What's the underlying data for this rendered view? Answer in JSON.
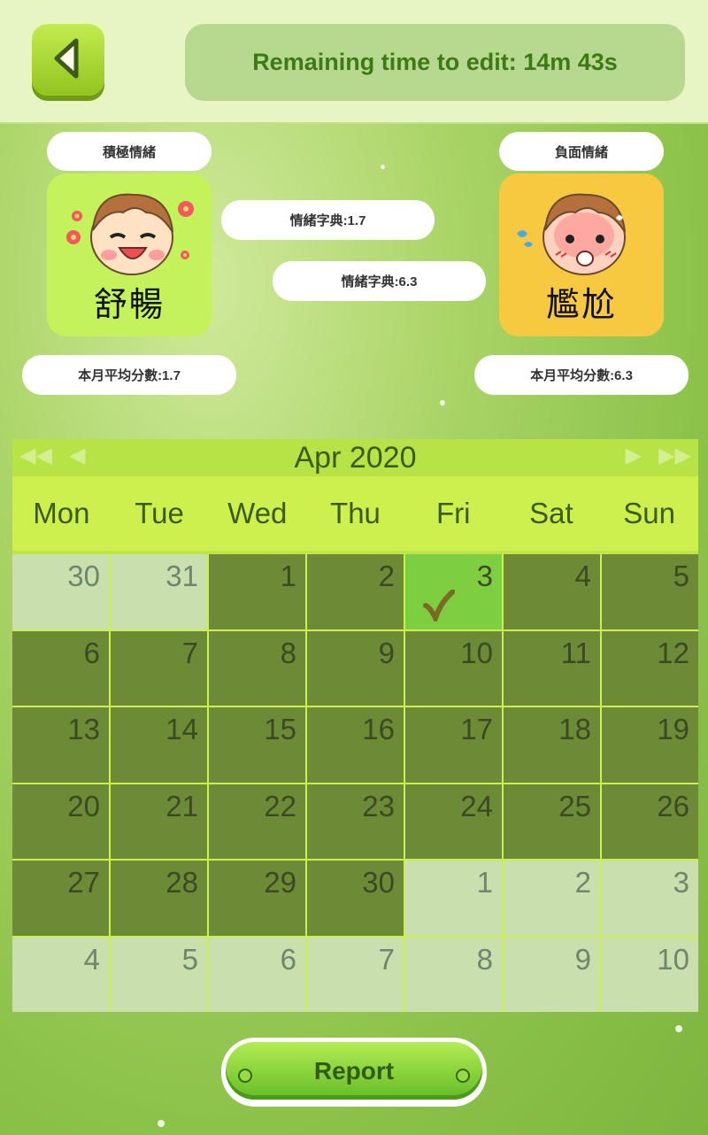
{
  "header": {
    "timer_text": "Remaining time to edit: 14m 43s"
  },
  "positive": {
    "category": "積極情緒",
    "mood_label": "舒暢",
    "dictionary": "情緒字典:1.7",
    "monthly_avg": "本月平均分數:1.7",
    "card_color": "#c3f25a"
  },
  "negative": {
    "category": "負面情緒",
    "mood_label": "尷尬",
    "dictionary": "情緒字典:6.3",
    "monthly_avg": "本月平均分數:6.3",
    "card_color": "#f6c940"
  },
  "calendar": {
    "month_label": "Apr 2020",
    "nav": {
      "prev_year": "◀◀",
      "prev_month": "◀",
      "next_month": "▶",
      "next_year": "▶▶"
    },
    "weekdays": [
      "Mon",
      "Tue",
      "Wed",
      "Thu",
      "Fri",
      "Sat",
      "Sun"
    ],
    "weeks": [
      [
        "30",
        "31",
        "1",
        "2",
        "3",
        "4",
        "5"
      ],
      [
        "6",
        "7",
        "8",
        "9",
        "10",
        "11",
        "12"
      ],
      [
        "13",
        "14",
        "15",
        "16",
        "17",
        "18",
        "19"
      ],
      [
        "20",
        "21",
        "22",
        "23",
        "24",
        "25",
        "26"
      ],
      [
        "27",
        "28",
        "29",
        "30",
        "1",
        "2",
        "3"
      ],
      [
        "4",
        "5",
        "6",
        "7",
        "8",
        "9",
        "10"
      ]
    ],
    "selected_day": "3"
  },
  "report_label": "Report",
  "colors": {
    "month_day": "#6d8a37",
    "other_day": "#cadfae",
    "selected_day": "#7ece42",
    "accent": "#3d7a16"
  }
}
